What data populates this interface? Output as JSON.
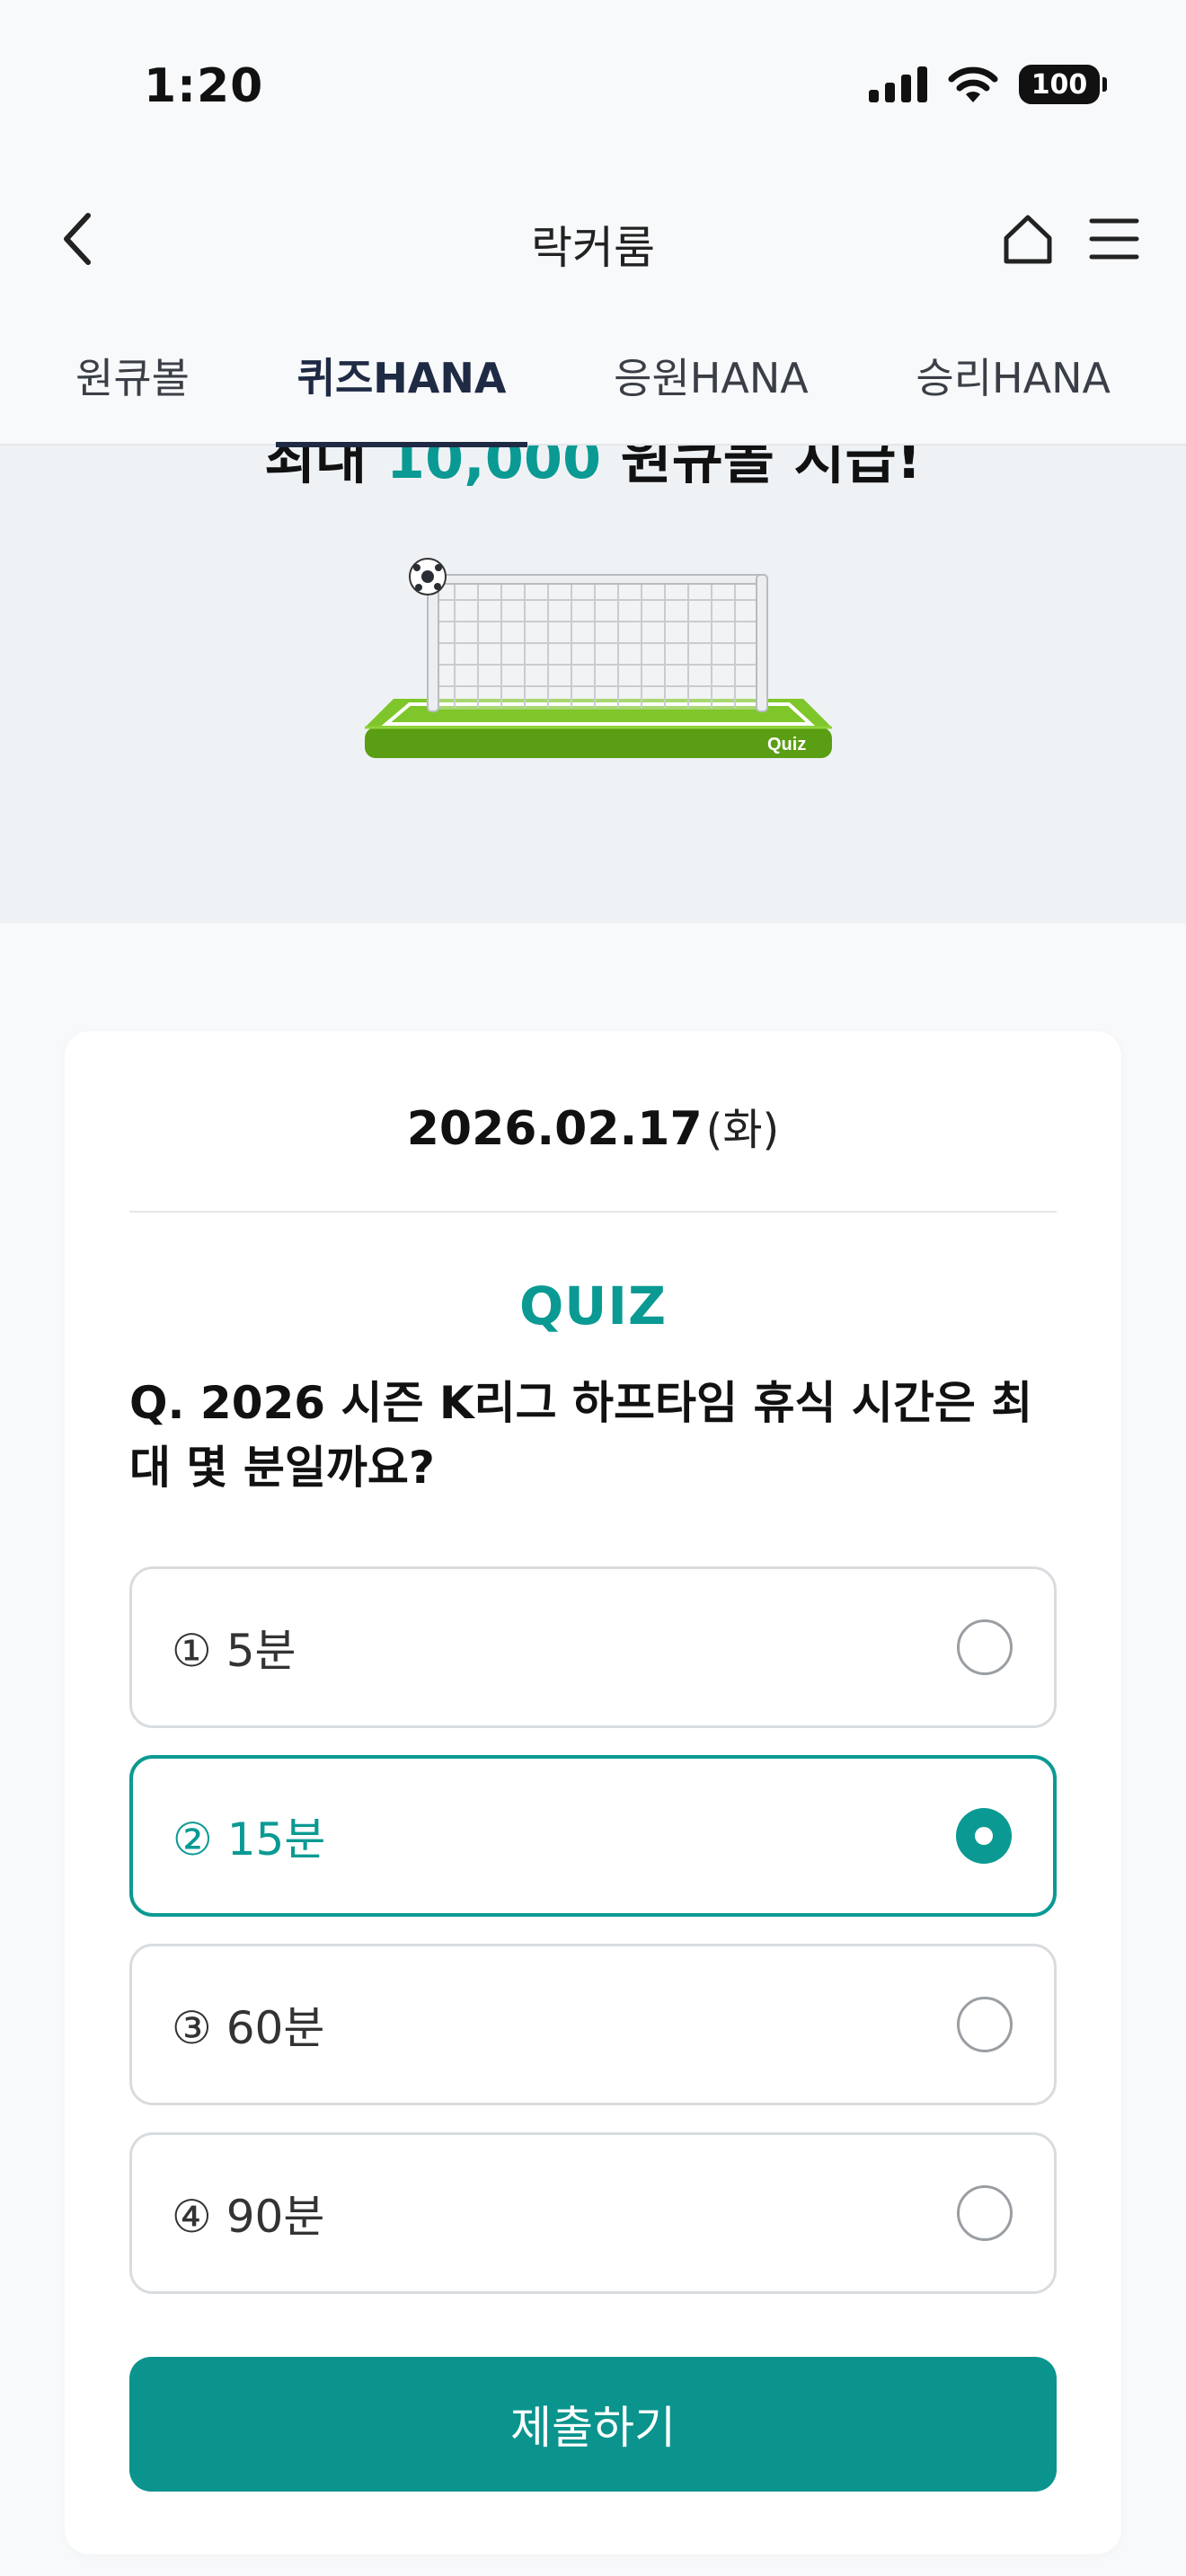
{
  "status_bar": {
    "time": "1:20",
    "battery": "100",
    "icons": [
      "signal-icon",
      "wifi-icon",
      "battery-icon"
    ]
  },
  "header": {
    "title": "락커룸",
    "icons": [
      "back-arrow-icon",
      "home-icon",
      "menu-icon"
    ]
  },
  "tabs": [
    {
      "label": "원큐볼",
      "active": false
    },
    {
      "label": "퀴즈HANA",
      "active": true
    },
    {
      "label": "응원HANA",
      "active": false
    },
    {
      "label": "승리HANA",
      "active": false
    }
  ],
  "banner": {
    "headline_prefix": "최대 ",
    "headline_accent": "10,000",
    "headline_suffix": " 원큐볼 지급!",
    "illustration_label": "Quiz"
  },
  "quiz": {
    "date": "2026.02.17",
    "weekday": "(화)",
    "label": "QUIZ",
    "question": "Q. 2026 시즌 K리그 하프타임 휴식 시간은 최대 몇 분일까요?",
    "options": [
      {
        "label": "① 5분",
        "selected": false
      },
      {
        "label": "② 15분",
        "selected": true
      },
      {
        "label": "③ 60분",
        "selected": false
      },
      {
        "label": "④ 90분",
        "selected": false
      }
    ],
    "submit_label": "제출하기"
  },
  "colors": {
    "accent": "#0a9a93",
    "tab_active": "#1f2a44",
    "banner_bg": "#eff2f5",
    "grass": "#6cb81c"
  }
}
